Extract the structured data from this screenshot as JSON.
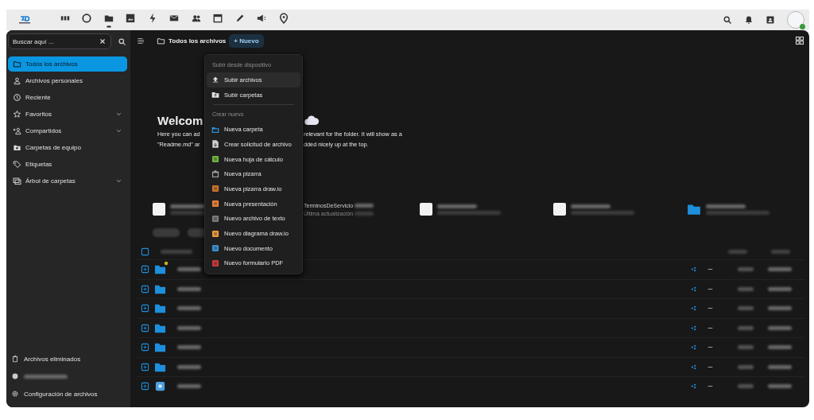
{
  "top_bar": {
    "apps": [
      {
        "kind": "dashboard",
        "selected": false
      },
      {
        "kind": "circle",
        "selected": false
      },
      {
        "kind": "files",
        "selected": true
      },
      {
        "kind": "photos",
        "selected": false
      },
      {
        "kind": "activity",
        "selected": false
      },
      {
        "kind": "mail",
        "selected": false
      },
      {
        "kind": "contacts",
        "selected": false
      },
      {
        "kind": "calendar",
        "selected": false
      },
      {
        "kind": "notes",
        "selected": false
      },
      {
        "kind": "announce",
        "selected": false
      },
      {
        "kind": "maps",
        "selected": false
      }
    ]
  },
  "sidebar": {
    "search": {
      "placeholder": "Buscar aquí ..."
    },
    "items": [
      {
        "label": "Todos los archivos",
        "selected": true,
        "expandable": false
      },
      {
        "label": "Archivos personales",
        "selected": false,
        "expandable": false
      },
      {
        "label": "Reciente",
        "selected": false,
        "expandable": false
      },
      {
        "label": "Favoritos",
        "selected": false,
        "expandable": true
      },
      {
        "label": "Compartidos",
        "selected": false,
        "expandable": true
      },
      {
        "label": "Carpetas de equipo",
        "selected": false,
        "expandable": false
      },
      {
        "label": "Etiquetas",
        "selected": false,
        "expandable": false
      },
      {
        "label": "Árbol de carpetas",
        "selected": false,
        "expandable": true
      }
    ],
    "footer": [
      {
        "kind": "link",
        "label": "Archivos eliminados"
      },
      {
        "kind": "blurred"
      },
      {
        "kind": "link",
        "label": "Configuración de archivos"
      }
    ]
  },
  "toolbar": {
    "breadcrumb": "Todos los archivos",
    "new_button": "+ Nuevo"
  },
  "welcome": {
    "title": "Welcom",
    "lines": [
      [
        "Here you can ad",
        "relevant for the folder. It will show as a"
      ],
      [
        "\"Readme.md\" ar",
        "dded nicely up at the top."
      ]
    ]
  },
  "recent": [
    {
      "kind": "file"
    },
    {
      "kind": "file",
      "name": "TerminosDeServicio",
      "meta": "Última actualización"
    },
    {
      "kind": "file"
    },
    {
      "kind": "file"
    },
    {
      "kind": "folder"
    }
  ],
  "rows": [
    {
      "kind": "folder",
      "badge": true
    },
    {
      "kind": "folder",
      "badge": false
    },
    {
      "kind": "folder",
      "badge": false
    },
    {
      "kind": "folder",
      "badge": false
    },
    {
      "kind": "folder",
      "badge": false
    },
    {
      "kind": "folder",
      "badge": false
    },
    {
      "kind": "image",
      "badge": false
    }
  ],
  "menu": {
    "sections": [
      {
        "header": "Subir desde dispositivo",
        "items": [
          {
            "label": "Subir archivos",
            "kind": "upload",
            "color": "#e0e0e0",
            "selected": true
          },
          {
            "label": "Subir carpetas",
            "kind": "folder-upload",
            "color": "#e0e0e0",
            "selected": false
          }
        ]
      },
      {
        "header": "Crear nuevo",
        "items": [
          {
            "label": "Nueva carpeta",
            "kind": "folder-new",
            "color": "#2f8fd8",
            "selected": false
          },
          {
            "label": "Crear solicitud de archivo",
            "kind": "file",
            "color": "#cfcfcf",
            "selected": false
          },
          {
            "label": "Nueva hoja de cálculo",
            "kind": "tile",
            "color": "#6fb43f",
            "selected": false
          },
          {
            "label": "Nueva pizarra",
            "kind": "board",
            "color": "#a0a0a0",
            "selected": false
          },
          {
            "label": "Nueva pizarra draw.io",
            "kind": "tile",
            "color": "#c8742a",
            "selected": false
          },
          {
            "label": "Nueva presentación",
            "kind": "tile",
            "color": "#e8803a",
            "selected": false
          },
          {
            "label": "Nuevo archivo de texto",
            "kind": "tile",
            "color": "#7a7a7a",
            "selected": false
          },
          {
            "label": "Nuevo diagrama draw.io",
            "kind": "tile",
            "color": "#e89a3a",
            "selected": false
          },
          {
            "label": "Nuevo documento",
            "kind": "tile",
            "color": "#3a8fd0",
            "selected": false
          },
          {
            "label": "Nuevo formulario PDF",
            "kind": "tile",
            "color": "#c83a3a",
            "selected": false
          }
        ]
      }
    ]
  }
}
